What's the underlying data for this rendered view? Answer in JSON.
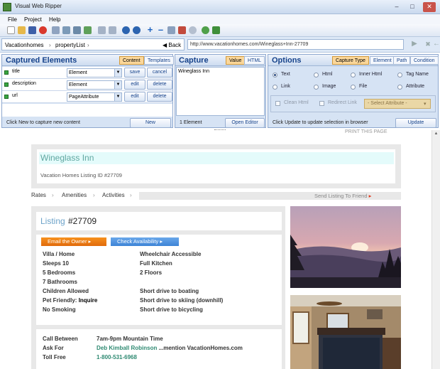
{
  "app": {
    "title": "Visual Web Ripper"
  },
  "menu": [
    "File",
    "Project",
    "Help"
  ],
  "nav": {
    "breadcrumb": [
      "Vacationhomes",
      "propertyList"
    ],
    "back_label": "Back",
    "url": "http://www.vacationhomes.com/Wineglass+Inn-27709"
  },
  "captured": {
    "title": "Captured Elements",
    "tabs": [
      "Content",
      "Templates"
    ],
    "rows": [
      {
        "name": "title",
        "type": "Element",
        "btn1": "save",
        "btn2": "cancel"
      },
      {
        "name": "description",
        "type": "Element",
        "btn1": "edit",
        "btn2": "delete"
      },
      {
        "name": "url",
        "type": "PageAttribute",
        "btn1": "edit",
        "btn2": "delete"
      }
    ],
    "status": "Click New to capture new content",
    "new_label": "New"
  },
  "capture": {
    "title": "Capture",
    "tabs": [
      "Value",
      "HTML"
    ],
    "value": "Wineglass Inn",
    "count": "1 Element",
    "open_editor": "Open Editor"
  },
  "options": {
    "title": "Options",
    "tabs": [
      "Capture Type",
      "Element",
      "Path",
      "Condition"
    ],
    "radios": [
      {
        "label": "Text",
        "checked": true
      },
      {
        "label": "Html",
        "checked": false
      },
      {
        "label": "Inner Html",
        "checked": false
      },
      {
        "label": "Tag Name",
        "checked": false
      },
      {
        "label": "Link",
        "checked": false
      },
      {
        "label": "Image",
        "checked": false
      },
      {
        "label": "File",
        "checked": false
      },
      {
        "label": "Attribute",
        "checked": false
      }
    ],
    "clean_html": "Clean Html",
    "redirect_link": "Redirect Link",
    "select_attribute": "- Select Attribute -",
    "status": "Click Update to update selection in browser",
    "update_label": "Update"
  },
  "page": {
    "print_link": "PRINT THIS PAGE",
    "listing_name": "Wineglass Inn",
    "listing_id": "Vacation Homes Listing ID #27709",
    "tabs": [
      "Rates",
      "Amenities",
      "Activities"
    ],
    "send_friend": "Send Listing To Friend",
    "listing_word": "Listing",
    "listing_num": "#27709",
    "email_owner": "Email the Owner",
    "check_avail": "Check Availability",
    "details_left": [
      "Villa / Home",
      "Sleeps 10",
      "5 Bedrooms",
      "7 Bathrooms",
      "Children Allowed",
      "Pet Friendly:",
      "No Smoking"
    ],
    "pet_value": "Inquire",
    "details_right": [
      "Wheelchair Accessible",
      "Full Kitchen",
      "2 Floors",
      "",
      "Short drive to boating",
      "Short drive to skiing (downhill)",
      "Short drive to bicycling"
    ],
    "call_label": "Call Between",
    "call_value": "7am-9pm Mountain Time",
    "ask_label": "Ask For",
    "ask_value": "Deb Kimball Robinson",
    "ask_suffix": "...mention VacationHomes.com",
    "toll_label": "Toll Free",
    "toll_value": "1-800-531-6968"
  }
}
